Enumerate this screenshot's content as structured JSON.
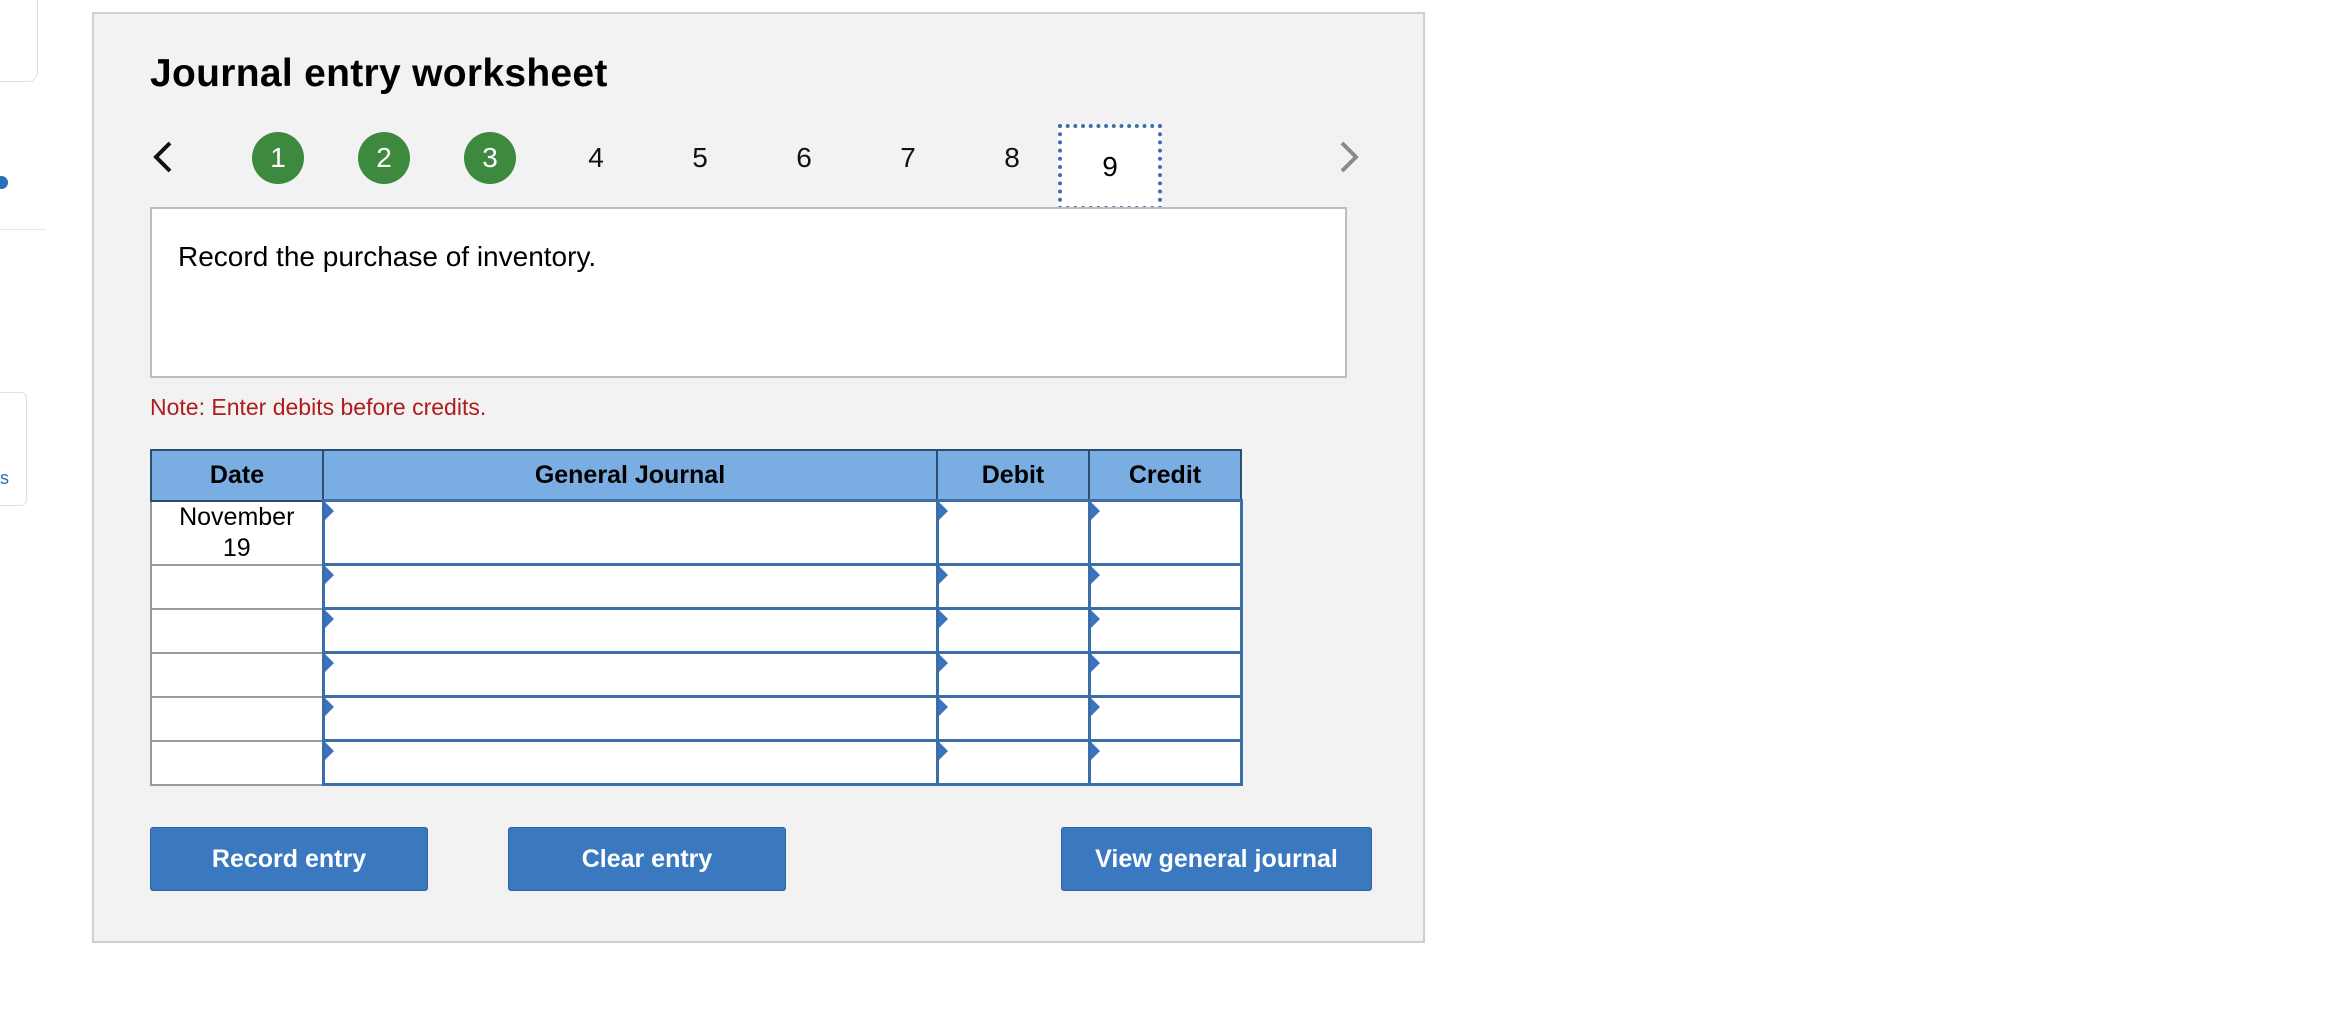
{
  "edge": {
    "glyph": "s"
  },
  "worksheet": {
    "title": "Journal entry worksheet",
    "steps": [
      "1",
      "2",
      "3",
      "4",
      "5",
      "6",
      "7",
      "8",
      "9"
    ],
    "completed_steps": [
      "1",
      "2",
      "3"
    ],
    "current_step": "9",
    "instruction": "Record the purchase of inventory.",
    "note": "Note: Enter debits before credits.",
    "colors": {
      "completed": "#3d8a3f",
      "header": "#7aaee2",
      "button": "#3a78c0",
      "note": "#b01c1c"
    }
  },
  "table": {
    "headers": {
      "date": "Date",
      "journal": "General Journal",
      "debit": "Debit",
      "credit": "Credit"
    },
    "rows": [
      {
        "date": "November\n19",
        "account": "",
        "debit": "",
        "credit": ""
      },
      {
        "date": "",
        "account": "",
        "debit": "",
        "credit": ""
      },
      {
        "date": "",
        "account": "",
        "debit": "",
        "credit": ""
      },
      {
        "date": "",
        "account": "",
        "debit": "",
        "credit": ""
      },
      {
        "date": "",
        "account": "",
        "debit": "",
        "credit": ""
      },
      {
        "date": "",
        "account": "",
        "debit": "",
        "credit": ""
      }
    ]
  },
  "buttons": {
    "record": "Record entry",
    "clear": "Clear entry",
    "view": "View general journal"
  },
  "icons": {
    "prev": "chevron-left-icon",
    "next": "chevron-right-icon"
  }
}
